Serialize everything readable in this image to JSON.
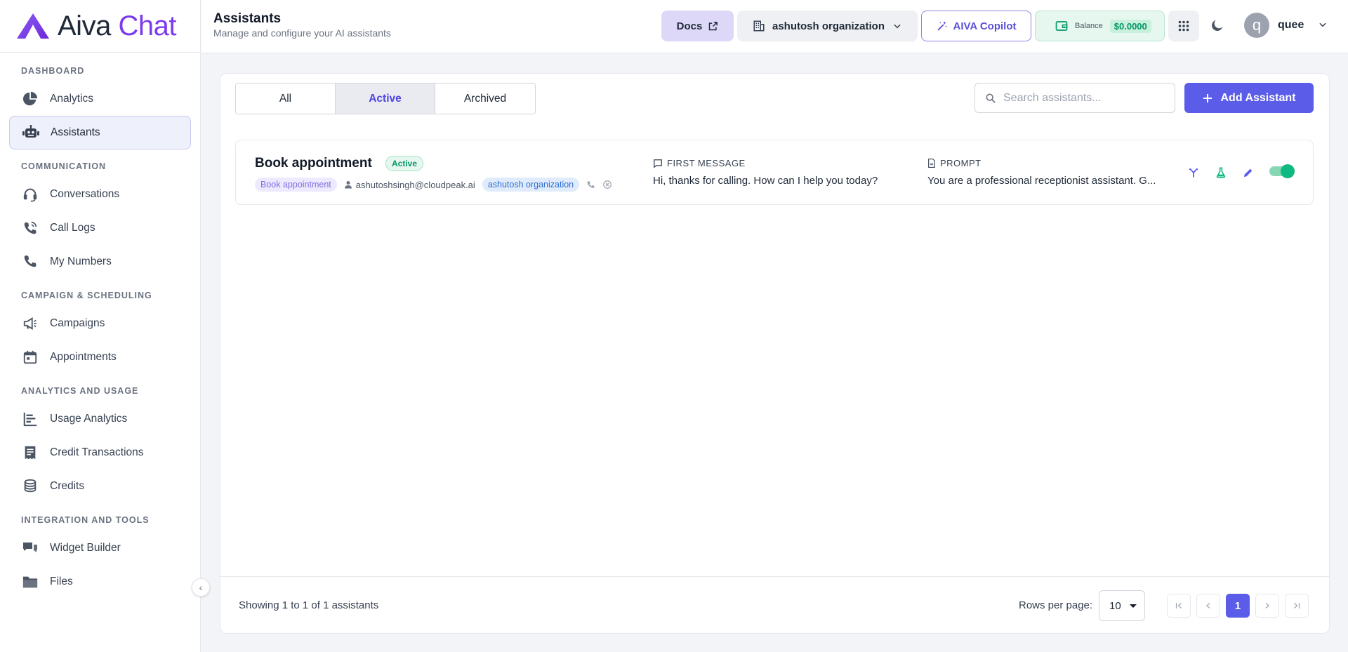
{
  "app": {
    "logo_word_1": "Aiva",
    "logo_word_2": "Chat",
    "brand_color": "#7c3aed",
    "accent_color": "#5b5ce8"
  },
  "sidebar": {
    "sections": [
      {
        "title": "DASHBOARD",
        "items": [
          {
            "label": "Analytics",
            "icon": "pie-chart-icon"
          },
          {
            "label": "Assistants",
            "icon": "robot-icon",
            "active": true
          }
        ]
      },
      {
        "title": "COMMUNICATION",
        "items": [
          {
            "label": "Conversations",
            "icon": "headset-icon"
          },
          {
            "label": "Call Logs",
            "icon": "phone-history-icon"
          },
          {
            "label": "My Numbers",
            "icon": "phone-icon"
          }
        ]
      },
      {
        "title": "CAMPAIGN & SCHEDULING",
        "items": [
          {
            "label": "Campaigns",
            "icon": "megaphone-icon"
          },
          {
            "label": "Appointments",
            "icon": "calendar-icon"
          }
        ]
      },
      {
        "title": "ANALYTICS AND USAGE",
        "items": [
          {
            "label": "Usage Analytics",
            "icon": "bar-chart-icon"
          },
          {
            "label": "Credit Transactions",
            "icon": "receipt-icon"
          },
          {
            "label": "Credits",
            "icon": "coins-icon"
          }
        ]
      },
      {
        "title": "INTEGRATION AND TOOLS",
        "items": [
          {
            "label": "Widget Builder",
            "icon": "chat-bubbles-icon"
          },
          {
            "label": "Files",
            "icon": "folder-icon"
          }
        ]
      }
    ]
  },
  "header": {
    "title": "Assistants",
    "subtitle": "Manage and configure your AI assistants",
    "docs_label": "Docs",
    "org_label": "ashutosh organization",
    "copilot_label": "AIVA Copilot",
    "balance_label": "Balance",
    "balance_value": "$0.0000",
    "avatar_letter": "q",
    "username": "quee"
  },
  "main": {
    "tabs": [
      {
        "label": "All"
      },
      {
        "label": "Active",
        "active": true
      },
      {
        "label": "Archived"
      }
    ],
    "search_placeholder": "Search assistants...",
    "add_button_label": "Add Assistant",
    "assistants": [
      {
        "name": "Book appointment",
        "status": "Active",
        "tag": "Book appointment",
        "owner": "ashutoshsingh@cloudpeak.ai",
        "org": "ashutosh organization",
        "first_message_label": "FIRST MESSAGE",
        "first_message": "Hi, thanks for calling. How can I help you today?",
        "prompt_label": "PROMPT",
        "prompt": "You are a professional receptionist assistant. G...",
        "enabled": true
      }
    ],
    "footer": {
      "showing_text": "Showing 1 to 1 of 1 assistants",
      "rows_per_page_label": "Rows per page:",
      "rows_per_page_value": "10",
      "current_page": "1"
    }
  }
}
